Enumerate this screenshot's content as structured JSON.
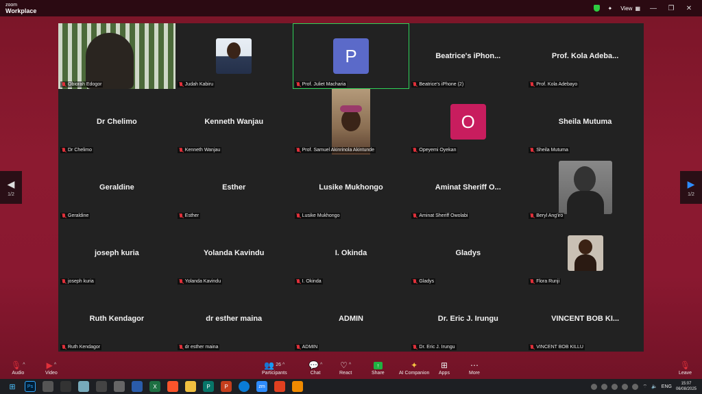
{
  "app": {
    "brand_top": "zoom",
    "brand_bottom": "Workplace",
    "view_label": "View"
  },
  "pager": {
    "left_label": "1/2",
    "right_label": "1/2"
  },
  "participants": [
    {
      "big": "",
      "label": "Obiorah Edogor",
      "kind": "video-obiorah"
    },
    {
      "big": "",
      "label": "Judah Kabiru",
      "kind": "photo-judah"
    },
    {
      "big": "",
      "label": "Prof. Juliet Macharia",
      "kind": "letter",
      "letter": "P",
      "color": "#5b6ac9",
      "active": true
    },
    {
      "big": "Beatrice's iPhon...",
      "label": "Beatrice's iPhone (2)"
    },
    {
      "big": "Prof. Kola Adeba...",
      "label": "Prof. Kola Adebayo"
    },
    {
      "big": "Dr Chelimo",
      "label": "Dr Chelimo"
    },
    {
      "big": "Kenneth Wanjau",
      "label": "Kenneth Wanjau"
    },
    {
      "big": "",
      "label": "Prof. Samuel Akinrinola Akintunde",
      "kind": "video-samuel"
    },
    {
      "big": "",
      "label": "Opeyemi Oyekan",
      "kind": "letter",
      "letter": "O",
      "color": "#c81d5e"
    },
    {
      "big": "Sheila Mutuma",
      "label": "Sheila Mutuma"
    },
    {
      "big": "Geraldine",
      "label": "Geraldine"
    },
    {
      "big": "Esther",
      "label": "Esther"
    },
    {
      "big": "Lusike Mukhongo",
      "label": "Lusike Mukhongo"
    },
    {
      "big": "Aminat Sheriff O...",
      "label": "Aminat Sheriff Owolabi"
    },
    {
      "big": "",
      "label": "Beryl Ang'iro",
      "kind": "photo-beryl"
    },
    {
      "big": "joseph kuria",
      "label": "joseph kuria"
    },
    {
      "big": "Yolanda Kavindu",
      "label": "Yolanda Kavindu"
    },
    {
      "big": "I. Okinda",
      "label": "I. Okinda"
    },
    {
      "big": "Gladys",
      "label": "Gladys"
    },
    {
      "big": "",
      "label": "Flora Runji",
      "kind": "photo-flora"
    },
    {
      "big": "Ruth Kendagor",
      "label": "Ruth Kendagor"
    },
    {
      "big": "dr esther maina",
      "label": "dr esther maina"
    },
    {
      "big": "ADMIN",
      "label": "ADMIN"
    },
    {
      "big": "Dr. Eric J. Irungu",
      "label": "Dr. Eric J. Irungu"
    },
    {
      "big": "VINCENT BOB KI...",
      "label": "VINCENT BOB KILLU"
    }
  ],
  "toolbar": {
    "audio": "Audio",
    "video": "Video",
    "participants": "Participants",
    "participants_count": "26",
    "chat": "Chat",
    "react": "React",
    "share": "Share",
    "ai_companion": "AI Companion",
    "apps": "Apps",
    "more": "More",
    "leave": "Leave"
  },
  "taskbar": {
    "language": "ENG",
    "time": "15:07",
    "date": "06/08/2025"
  }
}
